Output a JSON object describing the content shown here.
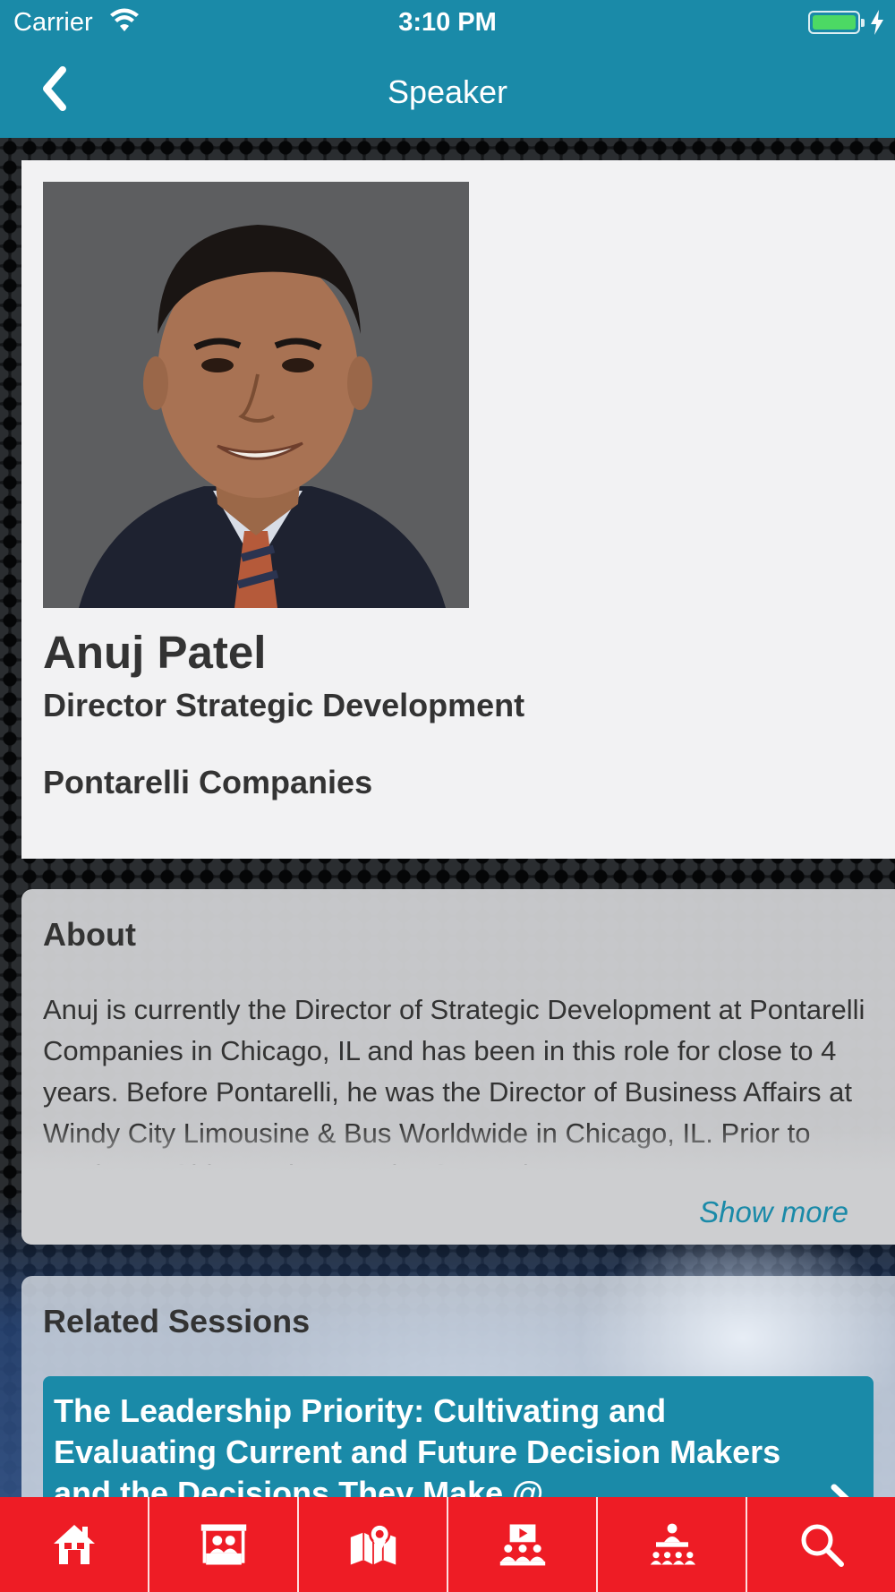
{
  "status_bar": {
    "carrier": "Carrier",
    "time": "3:10 PM"
  },
  "nav": {
    "title": "Speaker",
    "back_icon": "chevron-left-icon"
  },
  "speaker": {
    "name": "Anuj Patel",
    "title": "Director Strategic Development",
    "company": "Pontarelli Companies"
  },
  "about": {
    "heading": "About",
    "text": "Anuj is currently the Director of Strategic Development at Pontarelli Companies in Chicago, IL and has been in this role for close to 4 years.  Before Pontarelli, he was the Director of Business Affairs at Windy City Limousine & Bus Worldwide in Chicago, IL.  Prior to moving to Chicago, he was the General",
    "show_more": "Show more"
  },
  "related_sessions": {
    "heading": "Related Sessions",
    "items": [
      {
        "title": "The Leadership Priority: Cultivating and Evaluating Current and Future Decision Makers and the Decisions They Make @"
      }
    ]
  },
  "tab_bar": {
    "tabs": [
      {
        "icon": "home-icon"
      },
      {
        "icon": "exhibitors-booth-icon"
      },
      {
        "icon": "map-icon"
      },
      {
        "icon": "sessions-icon"
      },
      {
        "icon": "speakers-icon"
      },
      {
        "icon": "search-icon"
      }
    ]
  },
  "colors": {
    "primary": "#1a8aa8",
    "tab_bar": "#ee1c25",
    "battery": "#4cd964"
  }
}
